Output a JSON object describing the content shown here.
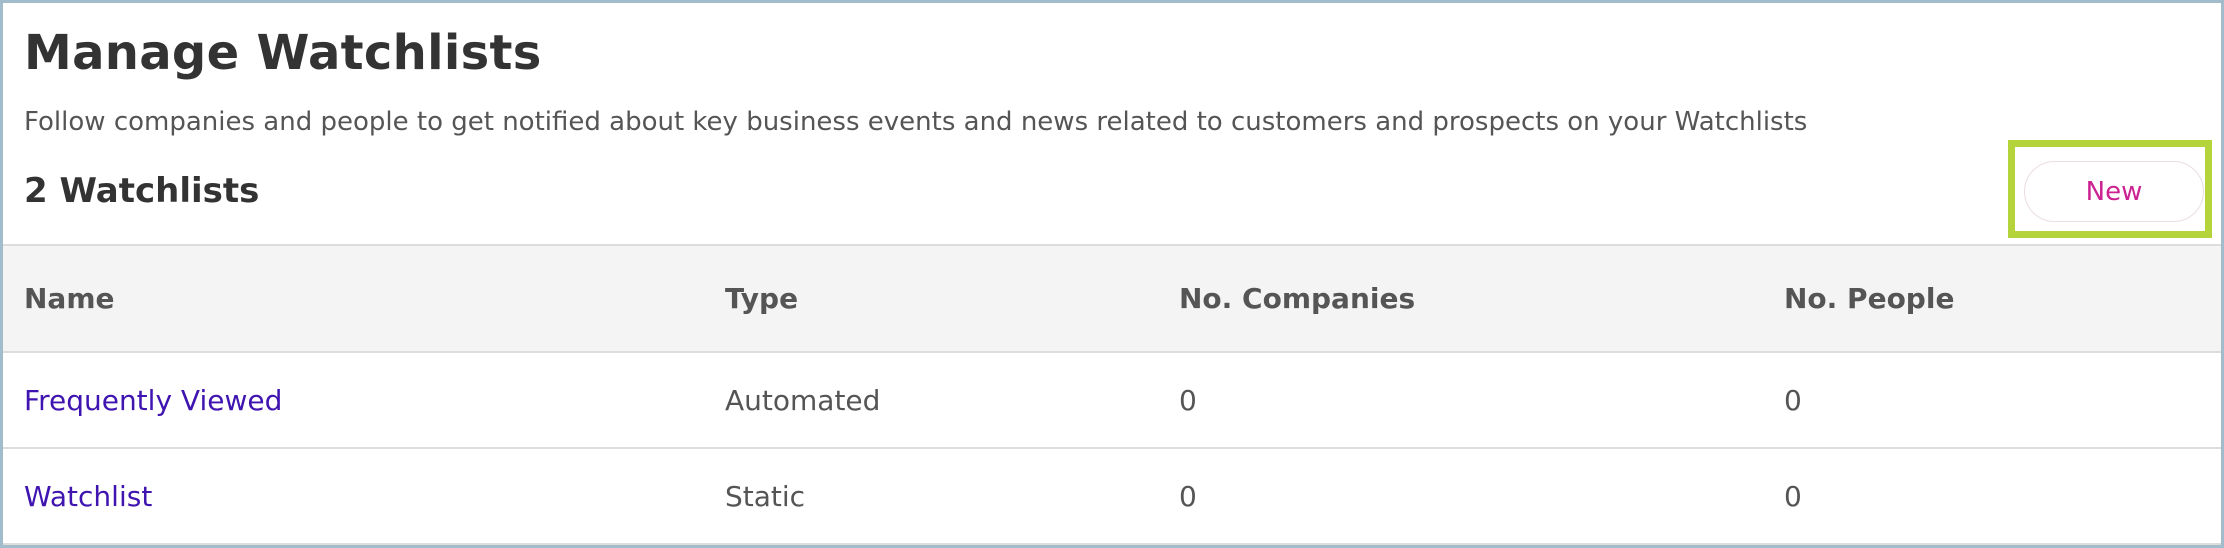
{
  "page": {
    "title": "Manage Watchlists",
    "description": "Follow companies and people to get notified about key business events and news related to customers and prospects on your Watchlists",
    "count_label": "2 Watchlists"
  },
  "toolbar": {
    "new_label": "New"
  },
  "table": {
    "columns": {
      "name": "Name",
      "type": "Type",
      "companies": "No. Companies",
      "people": "No. People"
    },
    "rows": [
      {
        "name": "Frequently Viewed",
        "type": "Automated",
        "companies": "0",
        "people": "0"
      },
      {
        "name": "Watchlist",
        "type": "Static",
        "companies": "0",
        "people": "0"
      }
    ]
  },
  "colors": {
    "accent": "#cc2292",
    "link": "#3f14b0",
    "highlight": "#b5d43b",
    "header_bg": "#f4f4f4"
  }
}
